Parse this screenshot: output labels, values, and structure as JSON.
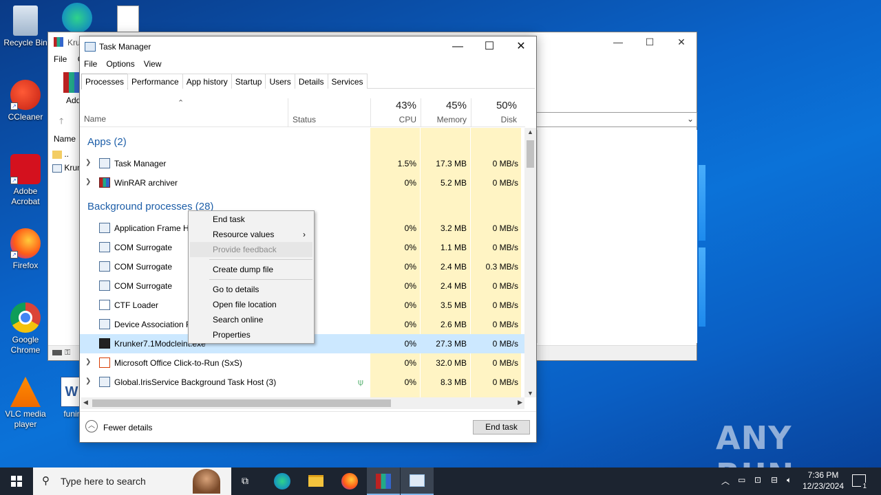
{
  "desktop": {
    "icons": [
      {
        "label": "Recycle Bin"
      },
      {
        "label": "CCleaner"
      },
      {
        "label": "Adobe Acrobat"
      },
      {
        "label": "Firefox"
      },
      {
        "label": "Google Chrome"
      },
      {
        "label": "VLC media player"
      },
      {
        "label": "funir"
      }
    ],
    "watermark": "ANY RUN"
  },
  "winrar": {
    "title": "Kru",
    "menu": [
      "File",
      "C"
    ],
    "toolbar_add": "Add",
    "col_name": "Name",
    "rows": [
      "..",
      "Krun"
    ]
  },
  "taskmanager": {
    "title": "Task Manager",
    "menu": [
      "File",
      "Options",
      "View"
    ],
    "tabs": [
      "Processes",
      "Performance",
      "App history",
      "Startup",
      "Users",
      "Details",
      "Services"
    ],
    "columns": {
      "name": "Name",
      "status": "Status",
      "cpu_pct": "43%",
      "cpu": "CPU",
      "mem_pct": "45%",
      "mem": "Memory",
      "disk_pct": "50%",
      "disk": "Disk"
    },
    "groups": {
      "apps": "Apps (2)",
      "background": "Background processes (28)"
    },
    "apps": [
      {
        "name": "Task Manager",
        "cpu": "1.5%",
        "mem": "17.3 MB",
        "disk": "0 MB/s"
      },
      {
        "name": "WinRAR archiver",
        "cpu": "0%",
        "mem": "5.2 MB",
        "disk": "0 MB/s"
      }
    ],
    "background": [
      {
        "name": "Application Frame H",
        "cpu": "0%",
        "mem": "3.2 MB",
        "disk": "0 MB/s"
      },
      {
        "name": "COM Surrogate",
        "cpu": "0%",
        "mem": "1.1 MB",
        "disk": "0 MB/s"
      },
      {
        "name": "COM Surrogate",
        "cpu": "0%",
        "mem": "2.4 MB",
        "disk": "0.3 MB/s"
      },
      {
        "name": "COM Surrogate",
        "cpu": "0%",
        "mem": "2.4 MB",
        "disk": "0 MB/s"
      },
      {
        "name": "CTF Loader",
        "cpu": "0%",
        "mem": "3.5 MB",
        "disk": "0 MB/s"
      },
      {
        "name": "Device Association F",
        "cpu": "0%",
        "mem": "2.6 MB",
        "disk": "0 MB/s"
      },
      {
        "name": "Krunker7.1Modcleint.exe",
        "cpu": "0%",
        "mem": "27.3 MB",
        "disk": "0 MB/s"
      },
      {
        "name": "Microsoft Office Click-to-Run (SxS)",
        "cpu": "0%",
        "mem": "32.0 MB",
        "disk": "0 MB/s"
      },
      {
        "name": "Global.IrisService Background Task Host (3)",
        "cpu": "0%",
        "mem": "8.3 MB",
        "disk": "0 MB/s"
      }
    ],
    "fewer_details": "Fewer details",
    "end_task": "End task"
  },
  "context_menu": {
    "items": [
      "End task",
      "Resource values",
      "Provide feedback",
      "Create dump file",
      "Go to details",
      "Open file location",
      "Search online",
      "Properties"
    ]
  },
  "taskbar": {
    "search_placeholder": "Type here to search",
    "time": "7:36 PM",
    "date": "12/23/2024",
    "notif_count": "1"
  }
}
